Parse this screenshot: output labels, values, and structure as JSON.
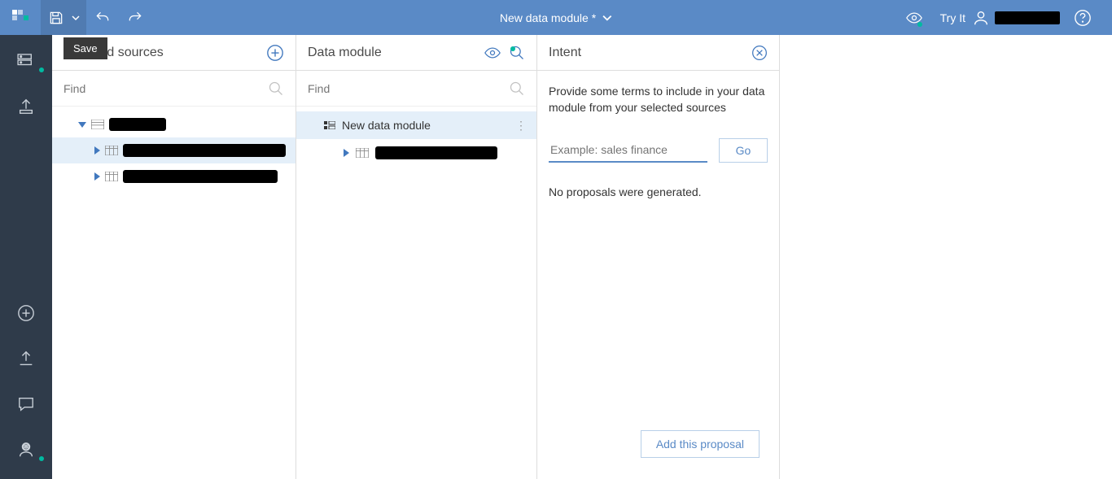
{
  "topbar": {
    "title": "New data module *",
    "save_tooltip": "Save",
    "tryit_label": "Try It"
  },
  "panels": {
    "sources": {
      "title": "Selected sources",
      "find_placeholder": "Find"
    },
    "module": {
      "title": "Data module",
      "find_placeholder": "Find",
      "root_label": "New data module"
    },
    "intent": {
      "title": "Intent",
      "description": "Provide some terms to include in your data module from your selected sources",
      "input_placeholder": "Example: sales finance",
      "go_label": "Go",
      "no_proposals": "No proposals were generated.",
      "add_proposal": "Add this proposal"
    }
  }
}
